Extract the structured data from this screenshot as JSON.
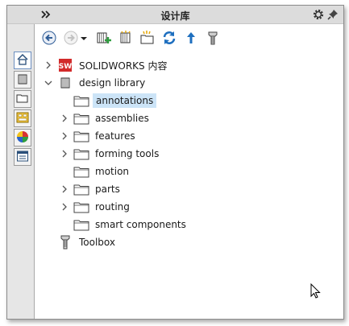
{
  "window": {
    "title": "设计库"
  },
  "side_tabs": [
    {
      "name": "side-tab-home",
      "icon": "home-icon"
    },
    {
      "name": "side-tab-design-library",
      "icon": "design-library-icon"
    },
    {
      "name": "side-tab-file-explorer",
      "icon": "folder-icon"
    },
    {
      "name": "side-tab-view-palette",
      "icon": "view-palette-icon"
    },
    {
      "name": "side-tab-appearances",
      "icon": "appearances-icon"
    },
    {
      "name": "side-tab-custom-properties",
      "icon": "custom-properties-icon"
    }
  ],
  "toolbar": [
    {
      "name": "back-button",
      "icon": "back-arrow-icon"
    },
    {
      "name": "forward-button",
      "icon": "forward-arrow-icon"
    },
    {
      "name": "history-dropdown",
      "icon": "dropdown-caret-icon"
    },
    {
      "name": "add-to-library-button",
      "icon": "add-to-library-icon"
    },
    {
      "name": "add-file-location-button",
      "icon": "add-file-location-icon"
    },
    {
      "name": "create-new-folder-button",
      "icon": "new-folder-icon"
    },
    {
      "name": "refresh-button",
      "icon": "refresh-icon"
    },
    {
      "name": "up-one-level-button",
      "icon": "up-arrow-icon"
    },
    {
      "name": "toolbox-button",
      "icon": "toolbox-bolt-icon"
    }
  ],
  "tree": [
    {
      "label": "SOLIDWORKS 内容",
      "icon": "solidworks-content-icon",
      "chevron": "right",
      "level": 0
    },
    {
      "label": "design library",
      "icon": "design-library-icon",
      "chevron": "down",
      "level": 0
    },
    {
      "label": "annotations",
      "icon": "folder-icon",
      "chevron": "none",
      "level": 1,
      "selected": true
    },
    {
      "label": "assemblies",
      "icon": "folder-icon",
      "chevron": "right",
      "level": 1
    },
    {
      "label": "features",
      "icon": "folder-icon",
      "chevron": "right",
      "level": 1
    },
    {
      "label": "forming tools",
      "icon": "folder-icon",
      "chevron": "right",
      "level": 1
    },
    {
      "label": "motion",
      "icon": "folder-icon",
      "chevron": "none",
      "level": 1
    },
    {
      "label": "parts",
      "icon": "folder-icon",
      "chevron": "right",
      "level": 1
    },
    {
      "label": "routing",
      "icon": "folder-icon",
      "chevron": "right",
      "level": 1
    },
    {
      "label": "smart components",
      "icon": "folder-icon",
      "chevron": "none",
      "level": 1
    },
    {
      "label": "Toolbox",
      "icon": "toolbox-bolt-icon",
      "chevron": "none",
      "level": 0
    }
  ],
  "colors": {
    "selection": "#cce4f7",
    "accent": "#1e6fbf",
    "titlebar": "#dcdcdc"
  }
}
